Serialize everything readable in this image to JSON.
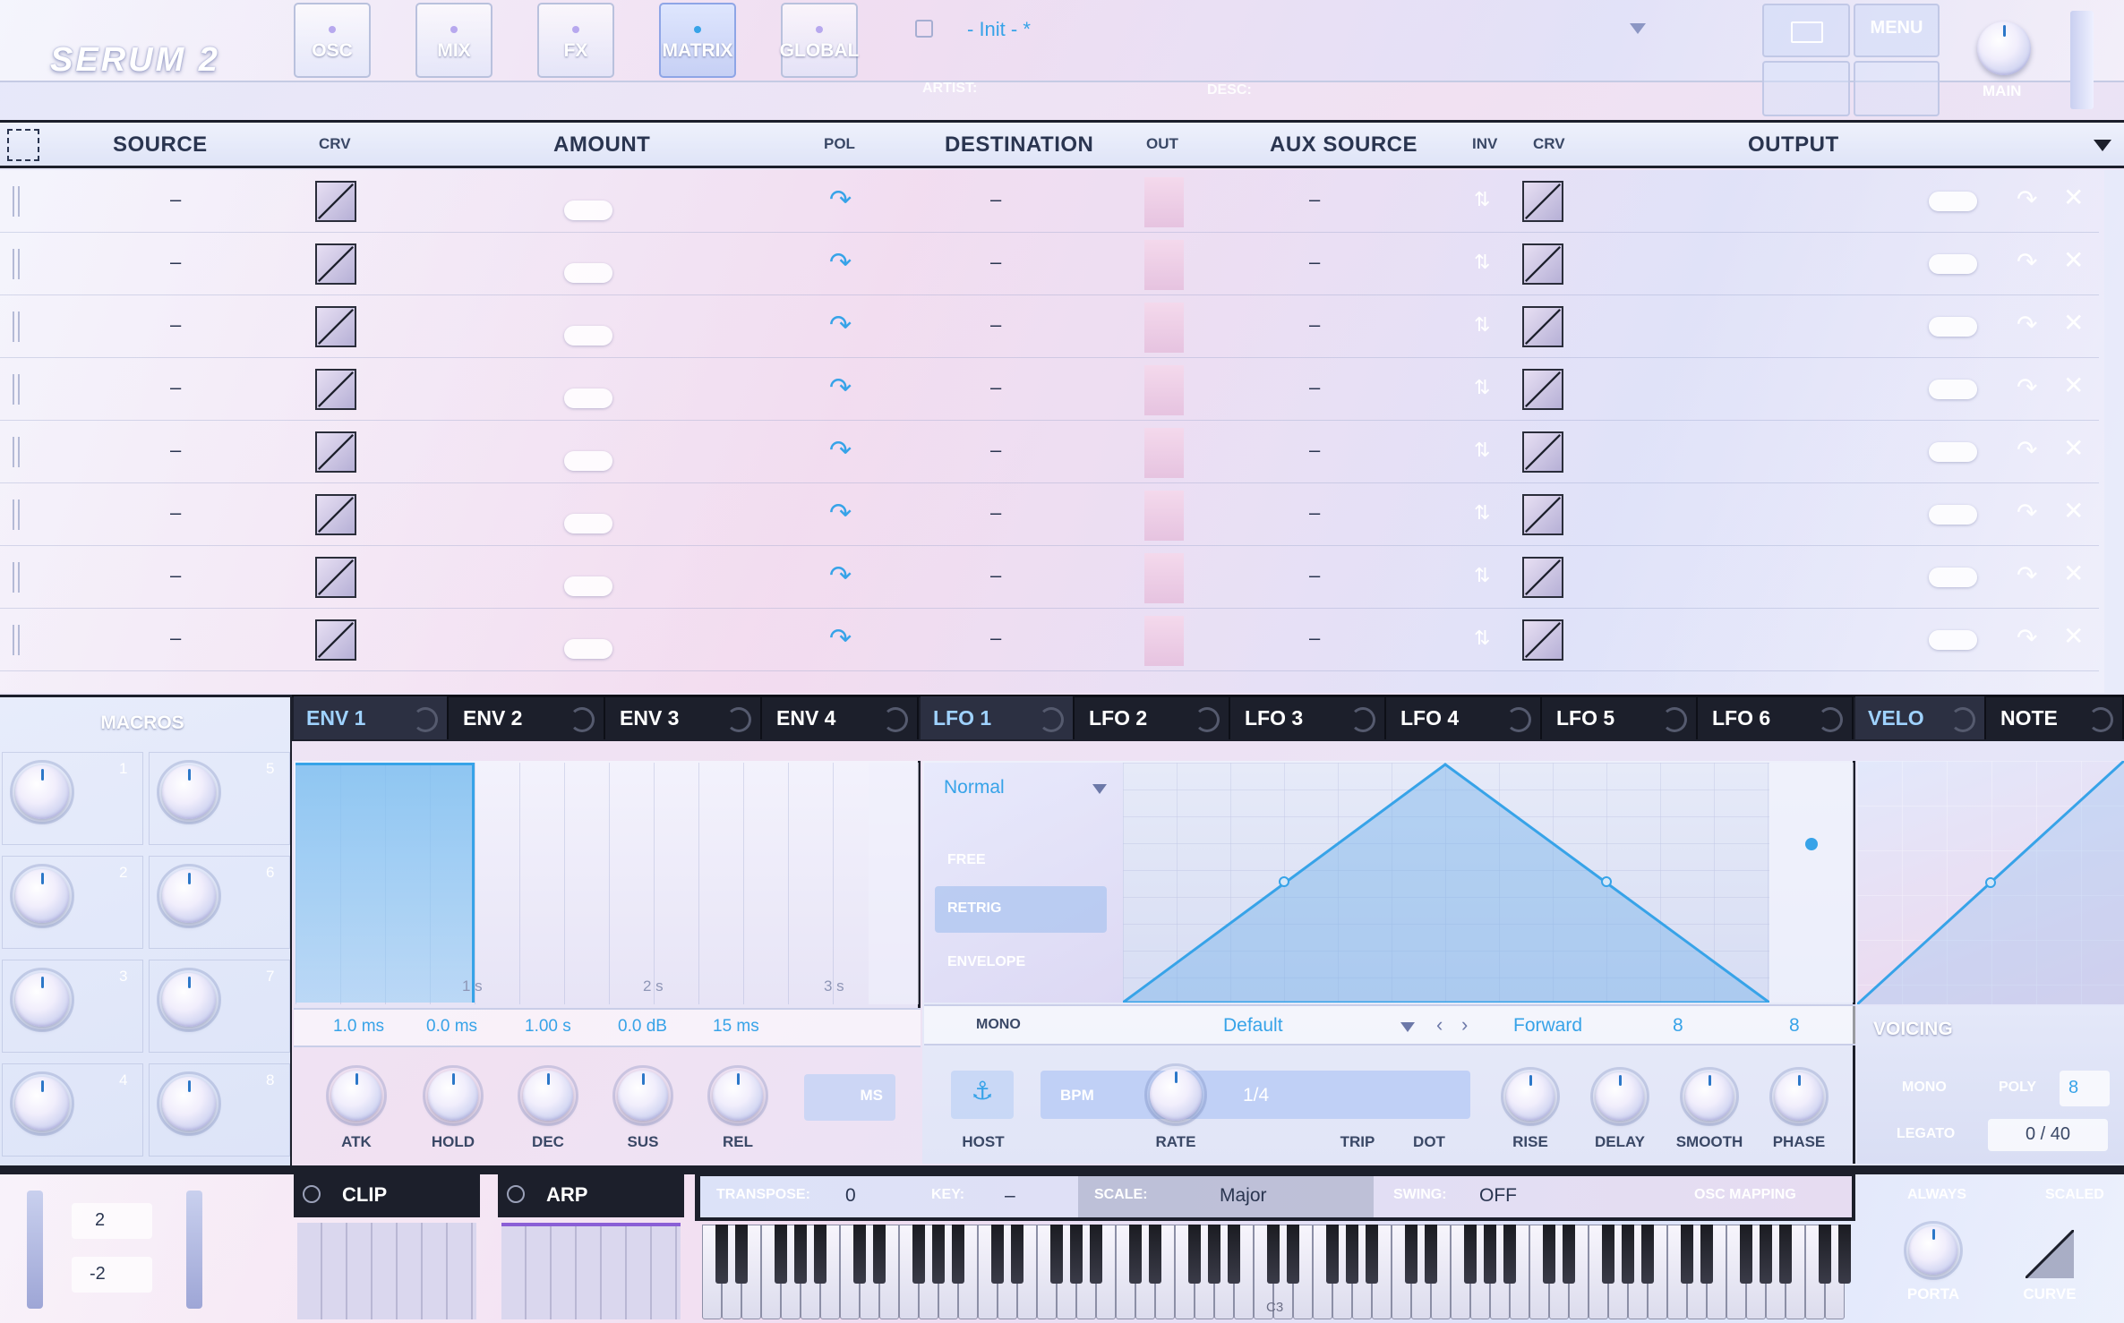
{
  "app": {
    "logo": "SERUM 2"
  },
  "tabs": [
    {
      "label": "OSC"
    },
    {
      "label": "MIX"
    },
    {
      "label": "FX"
    },
    {
      "label": "MATRIX"
    },
    {
      "label": "GLOBAL"
    }
  ],
  "preset": {
    "name": "- Init - *",
    "artist_label": "ARTIST:",
    "desc_label": "DESC:",
    "menu_label": "MENU",
    "main_label": "MAIN"
  },
  "matrix": {
    "headers": {
      "source": "SOURCE",
      "crv": "CRV",
      "amount": "AMOUNT",
      "pol": "POL",
      "destination": "DESTINATION",
      "out": "OUT",
      "aux_source": "AUX SOURCE",
      "inv": "INV",
      "crv2": "CRV",
      "output": "OUTPUT"
    },
    "rows": [
      {
        "source": "–",
        "destination": "–",
        "aux": "–"
      },
      {
        "source": "–",
        "destination": "–",
        "aux": "–"
      },
      {
        "source": "–",
        "destination": "–",
        "aux": "–"
      },
      {
        "source": "–",
        "destination": "–",
        "aux": "–"
      },
      {
        "source": "–",
        "destination": "–",
        "aux": "–"
      },
      {
        "source": "–",
        "destination": "–",
        "aux": "–"
      },
      {
        "source": "–",
        "destination": "–",
        "aux": "–"
      },
      {
        "source": "–",
        "destination": "–",
        "aux": "–"
      }
    ]
  },
  "macros": {
    "title": "MACROS",
    "numbers": [
      "1",
      "2",
      "3",
      "4",
      "5",
      "6",
      "7",
      "8"
    ]
  },
  "mod_tabs": [
    {
      "label": "ENV 1"
    },
    {
      "label": "ENV 2"
    },
    {
      "label": "ENV 3"
    },
    {
      "label": "ENV 4"
    },
    {
      "label": "LFO 1"
    },
    {
      "label": "LFO 2"
    },
    {
      "label": "LFO 3"
    },
    {
      "label": "LFO 4"
    },
    {
      "label": "LFO 5"
    },
    {
      "label": "LFO 6"
    },
    {
      "label": "VELO"
    },
    {
      "label": "NOTE"
    }
  ],
  "env": {
    "time_marks": [
      "1 s",
      "2 s",
      "3 s"
    ],
    "values": [
      "1.0 ms",
      "0.0 ms",
      "1.00 s",
      "0.0 dB",
      "15 ms"
    ],
    "knobs": [
      "ATK",
      "HOLD",
      "DEC",
      "SUS",
      "REL"
    ],
    "unit_button": "MS"
  },
  "lfo": {
    "mode": "Normal",
    "modes": [
      "FREE",
      "RETRIG",
      "ENVELOPE"
    ],
    "mono_label": "MONO",
    "preset": "Default",
    "direction": "Forward",
    "grid_x": "8",
    "grid_y": "8",
    "host_label": "HOST",
    "bpm_label": "BPM",
    "rate_value": "1/4",
    "rate_label": "RATE",
    "trip_label": "TRIP",
    "dot_label": "DOT",
    "knobs": [
      "RISE",
      "DELAY",
      "SMOOTH",
      "PHASE"
    ]
  },
  "voicing": {
    "title": "VOICING",
    "mono": "MONO",
    "poly": "POLY",
    "poly_value": "8",
    "legato": "LEGATO",
    "legato_value": "0 / 40"
  },
  "bottom": {
    "pitch_up": "2",
    "pitch_down": "-2",
    "clip": "CLIP",
    "arp": "ARP",
    "transpose_label": "TRANSPOSE:",
    "transpose_value": "0",
    "key_label": "KEY:",
    "key_value": "–",
    "scale_label": "SCALE:",
    "scale_value": "Major",
    "swing_label": "SWING:",
    "swing_value": "OFF",
    "osc_mapping": "OSC MAPPING",
    "c3": "C3",
    "always": "ALWAYS",
    "scaled": "SCALED",
    "porta": "PORTA",
    "curve": "CURVE"
  }
}
